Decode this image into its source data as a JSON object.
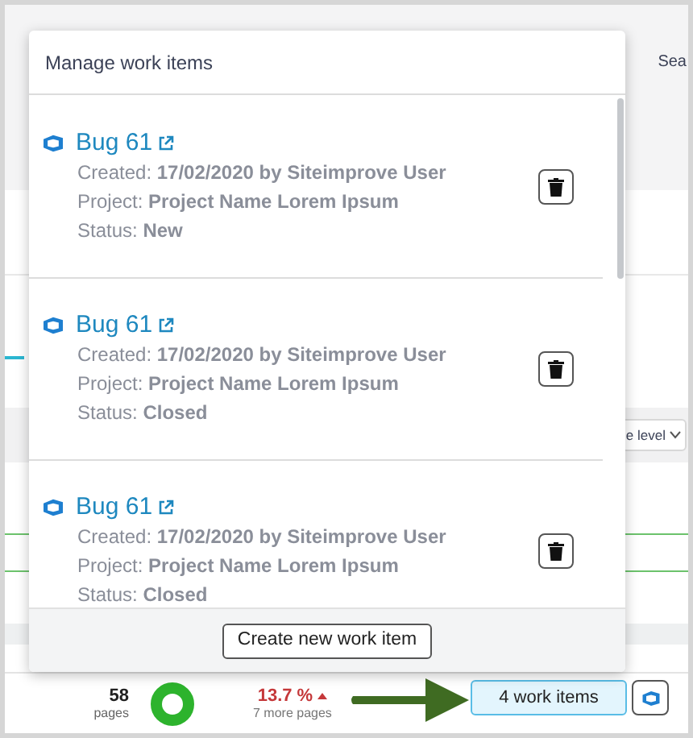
{
  "background": {
    "search_text": "Sea",
    "level_select": "e level"
  },
  "popover": {
    "title": "Manage work items",
    "items": [
      {
        "title": "Bug 61",
        "created": "Created: **17/02/2020 by Siteimprove User**",
        "project": "Project: **Project Name Lorem Ipsum**",
        "status": "Status: **New**"
      },
      {
        "title": "Bug 61",
        "created": "Created: **17/02/2020 by Siteimprove User**",
        "project": "Project: **Project Name Lorem Ipsum**",
        "status": "Status: **Closed**"
      },
      {
        "title": "Bug 61",
        "created": "Created: **17/02/2020 by Siteimprove User**",
        "project": "Project: **Project Name Lorem Ipsum**",
        "status": "Status: **Closed**"
      }
    ],
    "footer_button": "Create new work item"
  },
  "stats": {
    "count": "58",
    "count_label": "pages",
    "change": "13.7 %",
    "change_detail": "7 more pages",
    "work_items_button": "4 work items"
  }
}
